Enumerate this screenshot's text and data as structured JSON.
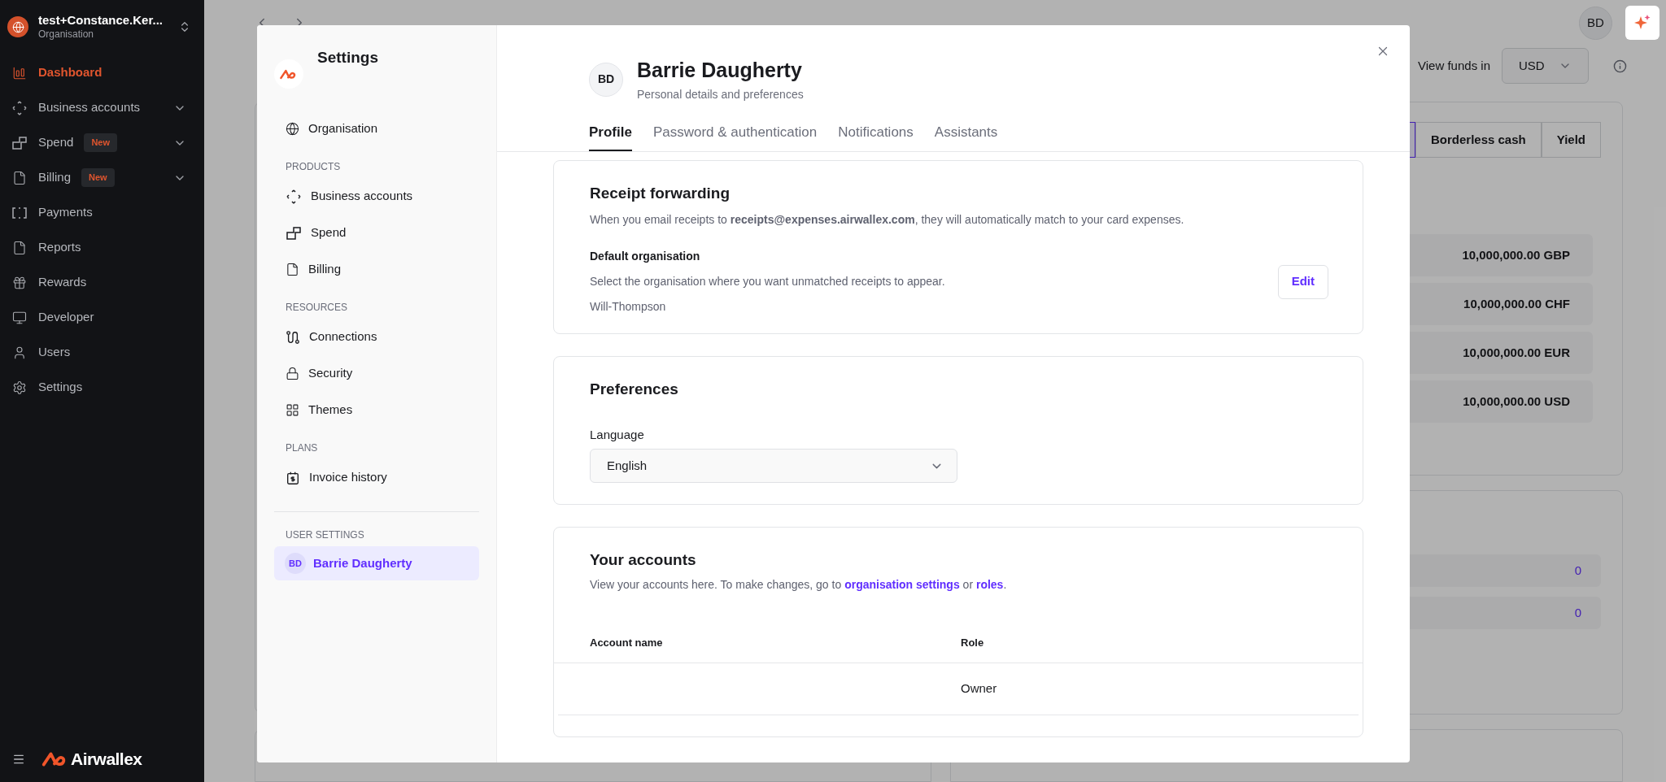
{
  "sidebar": {
    "org_name": "test+Constance.Ker...",
    "org_subtitle": "Organisation",
    "items": [
      {
        "label": "Dashboard",
        "selected": true,
        "expandable": false
      },
      {
        "label": "Business accounts",
        "selected": false,
        "expandable": true
      },
      {
        "label": "Spend",
        "selected": false,
        "expandable": true,
        "badge": "New"
      },
      {
        "label": "Billing",
        "selected": false,
        "expandable": true,
        "badge": "New"
      },
      {
        "label": "Payments",
        "selected": false,
        "expandable": false
      },
      {
        "label": "Reports",
        "selected": false,
        "expandable": false
      },
      {
        "label": "Rewards",
        "selected": false,
        "expandable": false
      },
      {
        "label": "Developer",
        "selected": false,
        "expandable": false
      },
      {
        "label": "Users",
        "selected": false,
        "expandable": false
      },
      {
        "label": "Settings",
        "selected": false,
        "expandable": false
      }
    ],
    "brand": "Airwallex"
  },
  "background": {
    "avatar": "BD",
    "view_funds_label": "View funds in",
    "currency": "USD",
    "tabs": [
      {
        "selected": true
      },
      {
        "label": "Borderless cash",
        "selected": false
      },
      {
        "label": "Yield",
        "selected": false
      }
    ],
    "balances": [
      "10,000,000.00 GBP",
      "10,000,000.00 CHF",
      "10,000,000.00 EUR",
      "10,000,000.00 USD"
    ],
    "counts": [
      "0",
      "0"
    ]
  },
  "modal": {
    "title": "Settings",
    "nav": [
      {
        "kind": "item",
        "label": "Organisation",
        "selected": false
      },
      {
        "kind": "heading",
        "label": "PRODUCTS"
      },
      {
        "kind": "item",
        "label": "Business accounts",
        "selected": false
      },
      {
        "kind": "item",
        "label": "Spend",
        "selected": false
      },
      {
        "kind": "item",
        "label": "Billing",
        "selected": false
      },
      {
        "kind": "heading",
        "label": "RESOURCES"
      },
      {
        "kind": "item",
        "label": "Connections",
        "selected": false
      },
      {
        "kind": "item",
        "label": "Security",
        "selected": false
      },
      {
        "kind": "item",
        "label": "Themes",
        "selected": false
      },
      {
        "kind": "heading",
        "label": "PLANS"
      },
      {
        "kind": "item",
        "label": "Invoice history",
        "selected": false
      },
      {
        "kind": "divider"
      },
      {
        "kind": "heading",
        "label": "USER SETTINGS"
      },
      {
        "kind": "user",
        "initials": "BD",
        "label": "Barrie Daugherty",
        "selected": true
      }
    ],
    "profile": {
      "initials": "BD",
      "name": "Barrie Daugherty",
      "subtitle": "Personal details and preferences"
    },
    "tabs": [
      {
        "label": "Profile",
        "selected": true
      },
      {
        "label": "Password & authentication",
        "selected": false
      },
      {
        "label": "Notifications",
        "selected": false
      },
      {
        "label": "Assistants",
        "selected": false
      }
    ],
    "receipt": {
      "title": "Receipt forwarding",
      "description": "When you email receipts to **receipts@expenses.airwallex.com**, they will automatically match to your card expenses.",
      "default_title": "Default organisation",
      "default_description": "Select the organisation where you want unmatched receipts to appear.",
      "default_value": "Will-Thompson",
      "edit_button": "Edit"
    },
    "preferences": {
      "title": "Preferences",
      "language_label": "Language",
      "language_value": "English"
    },
    "accounts": {
      "title": "Your accounts",
      "description": "View your accounts here. To make changes, go to",
      "link1": "organisation settings",
      "joiner": "or",
      "link2": "roles",
      "end": ".",
      "columns": [
        "Account name",
        "Role"
      ],
      "rows": [
        {
          "role": "Owner"
        }
      ]
    }
  }
}
